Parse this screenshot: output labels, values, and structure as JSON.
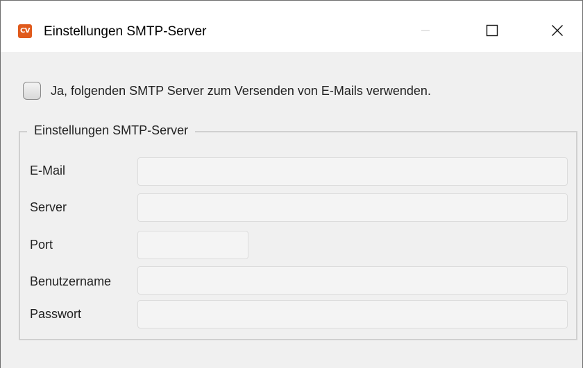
{
  "window": {
    "title": "Einstellungen SMTP-Server",
    "app_icon_text": "CV",
    "app_icon_color": "#e05a1c",
    "controls": {
      "minimize_icon": "minimize-icon",
      "maximize_icon": "maximize-icon",
      "close_icon": "close-icon"
    }
  },
  "use_smtp": {
    "label": "Ja, folgenden SMTP Server zum Versenden von E-Mails verwenden.",
    "checked": false
  },
  "group": {
    "title": "Einstellungen SMTP-Server",
    "fields": {
      "email": {
        "label": "E-Mail",
        "value": ""
      },
      "server": {
        "label": "Server",
        "value": ""
      },
      "port": {
        "label": "Port",
        "value": ""
      },
      "username": {
        "label": "Benutzername",
        "value": ""
      },
      "password": {
        "label": "Passwort",
        "value": ""
      }
    }
  }
}
